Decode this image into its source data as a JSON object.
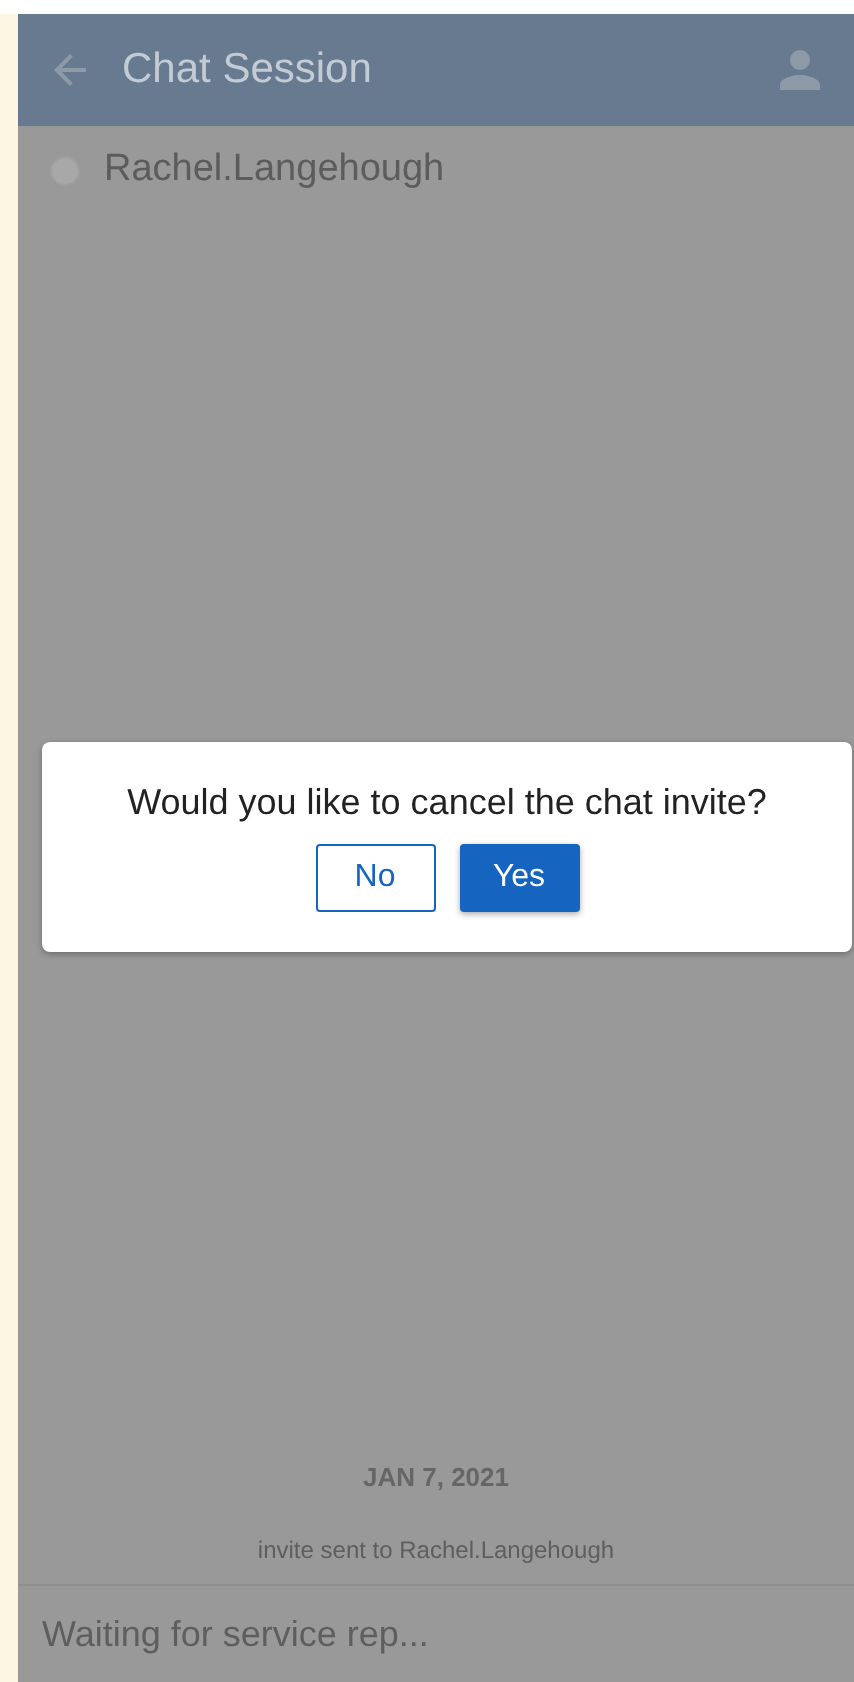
{
  "header": {
    "title": "Chat Session"
  },
  "participant": {
    "name": "Rachel.Langehough"
  },
  "messages": [
    {
      "kind": "date",
      "text": "JAN 7, 2021"
    },
    {
      "kind": "system",
      "text": "invite sent to Rachel.Langehough"
    }
  ],
  "composer": {
    "placeholder": "Waiting for service rep..."
  },
  "dialog": {
    "message": "Would you like to cancel the chat invite?",
    "buttons": [
      {
        "label": "No",
        "kind": "outline"
      },
      {
        "label": "Yes",
        "kind": "filled"
      }
    ]
  }
}
